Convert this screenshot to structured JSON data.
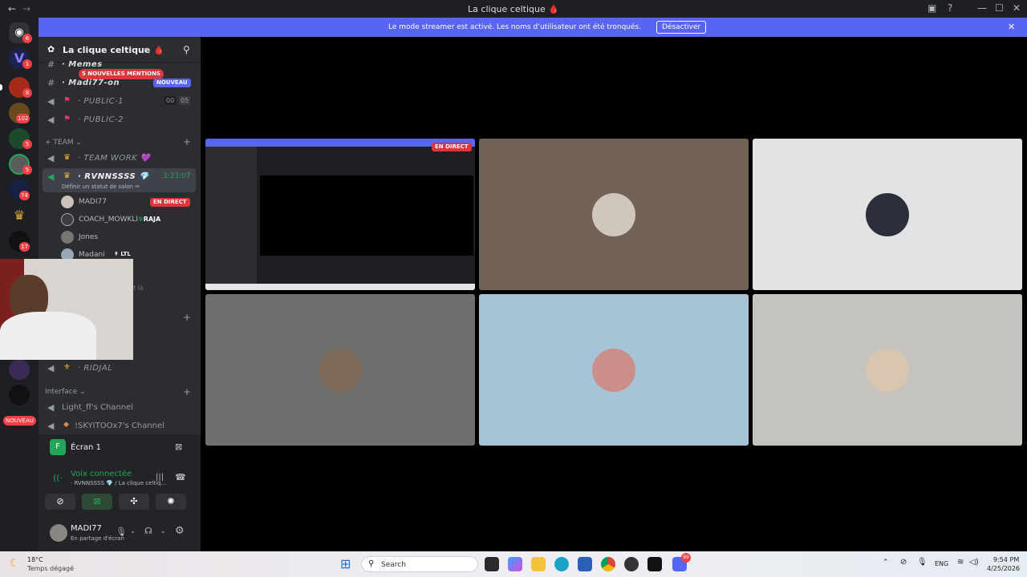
{
  "window": {
    "title": "La clique celtique 🩸"
  },
  "banner": {
    "message": "Le mode streamer est activé. Les noms d’utilisateur ont été tronqués.",
    "button": "Désactiver"
  },
  "servers": [
    {
      "badge": "6"
    },
    {
      "badge": "1"
    },
    {
      "badge": "8"
    },
    {
      "badge": "102"
    },
    {
      "badge": "5"
    },
    {
      "badge": "5"
    },
    {
      "badge": "74"
    },
    {
      "badge": ""
    },
    {
      "badge": "17"
    },
    {
      "badge": ""
    },
    {
      "badge": ""
    },
    {
      "badge": ""
    }
  ],
  "servers_new_label": "NOUVEAU",
  "sidebar": {
    "server_name": "La clique celtique 🩸",
    "mentions_pill": "5 NOUVELLES MENTIONS",
    "channels_top": [
      {
        "label": "· Memes",
        "prefix": "#"
      },
      {
        "label": "· Madi77-on",
        "prefix": "#",
        "tag": "NOUVEAU"
      },
      {
        "label": "· PUBLIC-1",
        "prefix": "🔊",
        "count_a": "00",
        "count_b": "05"
      },
      {
        "label": "· PUBLIC-2",
        "prefix": "🔊"
      }
    ],
    "team_category": "+ TEAM",
    "team_channels": [
      {
        "label": "· TEAM WORK 💜"
      },
      {
        "label": "· RVNNSSSS 💎",
        "timer": "3:23:07",
        "status": "Définir un statut de salon ✏"
      }
    ],
    "users": [
      {
        "name": "MADI77",
        "live": "EN DIRECT"
      },
      {
        "name": "COACH_MOWKLI",
        "tag": "RAJA"
      },
      {
        "name": "Jones"
      },
      {
        "name": "Madani",
        "tag": "LTL"
      }
    ],
    "hidden_fragment": "it là",
    "ridjal": "· RIDJAL",
    "interface_category": "Interface",
    "interface_channels": [
      "Light_ff's Channel",
      "!SKYITOOx7's Channel"
    ],
    "screen_panel": {
      "title": "Écran 1"
    },
    "voice": {
      "status": "Voix connectée",
      "location": "· RVNNSSSS 💎 / La clique celtiq..."
    },
    "user": {
      "name": "MADI77",
      "status": "En partage d'écran"
    }
  },
  "stage": {
    "stream_label": "EN DIRECT",
    "tiles": [
      {
        "kind": "screen",
        "bg": "#1e1f22"
      },
      {
        "kind": "avatar",
        "bg": "#736357",
        "avatar": "#cfc7bd"
      },
      {
        "kind": "avatar",
        "bg": "#e3e3e5",
        "avatar": "#2a2f3a"
      },
      {
        "kind": "avatar",
        "bg": "#6f706e",
        "avatar": "#7e6b5b"
      },
      {
        "kind": "avatar",
        "bg": "#a6c3d7",
        "avatar": "#c98f88"
      },
      {
        "kind": "avatar",
        "bg": "#c4c3be",
        "avatar": "#d8c7ae"
      }
    ]
  },
  "taskbar": {
    "weather_temp": "18°C",
    "weather_desc": "Temps dégagé",
    "search": "Search",
    "lang": "ENG",
    "time": "9:54 PM",
    "date": "4/25/2026",
    "discord_badge": "99"
  }
}
